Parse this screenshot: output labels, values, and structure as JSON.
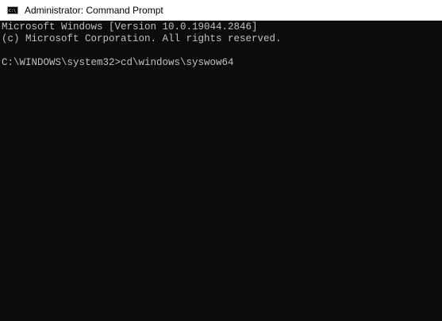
{
  "window": {
    "title": "Administrator: Command Prompt",
    "icon": "cmd-icon"
  },
  "console": {
    "lines": [
      "Microsoft Windows [Version 10.0.19044.2846]",
      "(c) Microsoft Corporation. All rights reserved.",
      "",
      "C:\\WINDOWS\\system32>cd\\windows\\syswow64"
    ]
  },
  "colors": {
    "titlebar_bg": "#ffffff",
    "console_bg": "#0c0c0c",
    "console_text": "#c0c0c0"
  }
}
